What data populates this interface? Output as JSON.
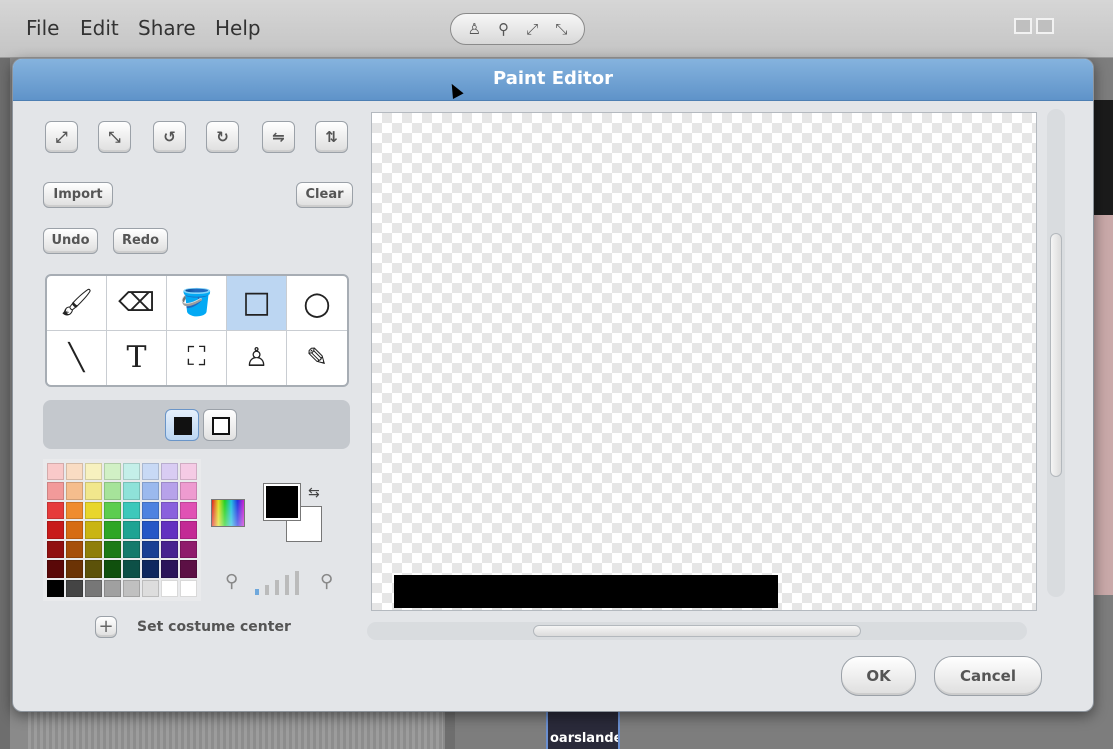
{
  "menubar": {
    "items": [
      "File",
      "Edit",
      "Share",
      "Help"
    ],
    "tool_icons": [
      "stamp-icon",
      "wand-icon",
      "grow-icon",
      "shrink-icon"
    ]
  },
  "dialog": {
    "title": "Paint Editor",
    "transform_tools": [
      "grow-icon",
      "shrink-icon",
      "rotate-ccw-icon",
      "rotate-cw-icon",
      "flip-horizontal-icon",
      "flip-vertical-icon"
    ],
    "import_label": "Import",
    "clear_label": "Clear",
    "undo_label": "Undo",
    "redo_label": "Redo",
    "tools": [
      {
        "name": "paintbrush",
        "glyph": "🖌",
        "selected": false
      },
      {
        "name": "eraser",
        "glyph": "⌫",
        "selected": false
      },
      {
        "name": "fill-bucket",
        "glyph": "🪣",
        "selected": false
      },
      {
        "name": "rectangle",
        "glyph": "□",
        "selected": true
      },
      {
        "name": "ellipse",
        "glyph": "○",
        "selected": false
      },
      {
        "name": "line",
        "glyph": "╲",
        "selected": false
      },
      {
        "name": "text",
        "glyph": "T",
        "selected": false
      },
      {
        "name": "select",
        "glyph": "⛶",
        "selected": false
      },
      {
        "name": "stamp",
        "glyph": "♙",
        "selected": false
      },
      {
        "name": "eyedropper",
        "glyph": "✎",
        "selected": false
      }
    ],
    "fill_modes": [
      "filled",
      "outlined"
    ],
    "selected_fill_mode": "filled",
    "foreground_color": "#000000",
    "background_color": "#ffffff",
    "set_center_label": "Set costume center",
    "ok_label": "OK",
    "cancel_label": "Cancel",
    "zoom_level_bars": 4,
    "zoom_level_active": 1
  },
  "palette": [
    "#f9c9c9",
    "#f9dcc3",
    "#f7f1bf",
    "#d1f0c5",
    "#c4efe9",
    "#c8d9f5",
    "#d9ccf3",
    "#f5cbe5",
    "#f29a9a",
    "#f5bd8d",
    "#f1e78c",
    "#a6e39a",
    "#8fe2d9",
    "#9bb9ee",
    "#b7a2ea",
    "#ee9bd0",
    "#e63b3b",
    "#ef8c2f",
    "#e8d62c",
    "#5ccd4f",
    "#3dc8bb",
    "#4f82e0",
    "#8a61dd",
    "#e052b4",
    "#c81a1a",
    "#d66c14",
    "#c9b514",
    "#2ea626",
    "#1ea393",
    "#2657c6",
    "#6232c0",
    "#c32a95",
    "#911010",
    "#a64f0a",
    "#8f7f0a",
    "#1d7a17",
    "#147a6c",
    "#193f94",
    "#47228f",
    "#8f1b6c",
    "#5a0808",
    "#6b3305",
    "#5c520a",
    "#10500d",
    "#0d5047",
    "#0f285f",
    "#2b155a",
    "#5c1045",
    "#000000",
    "#444444",
    "#777777",
    "#a0a0a0",
    "#c0c0c0",
    "#dddddd",
    "#ffffff",
    "#ffffff"
  ],
  "background": {
    "sprite_label": "oarslande"
  }
}
